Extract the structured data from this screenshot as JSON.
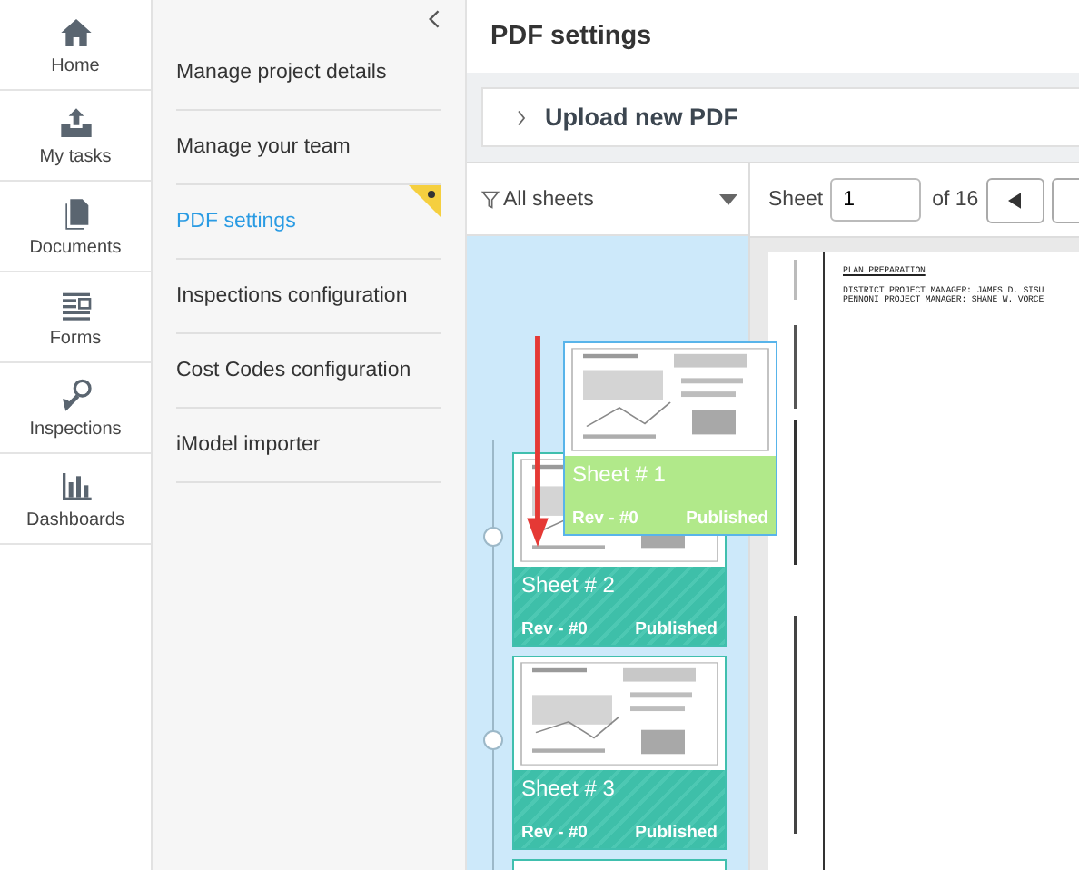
{
  "nav": [
    {
      "label": "Home"
    },
    {
      "label": "My tasks"
    },
    {
      "label": "Documents"
    },
    {
      "label": "Forms"
    },
    {
      "label": "Inspections"
    },
    {
      "label": "Dashboards"
    }
  ],
  "settings_menu": [
    {
      "label": "Manage project details",
      "selected": false
    },
    {
      "label": "Manage your team",
      "selected": false
    },
    {
      "label": "PDF settings",
      "selected": true
    },
    {
      "label": "Inspections configuration",
      "selected": false
    },
    {
      "label": "Cost Codes configuration",
      "selected": false
    },
    {
      "label": "iModel importer",
      "selected": false
    }
  ],
  "title": "PDF settings",
  "upload": {
    "label": "Upload new PDF",
    "expanded": false
  },
  "filter": {
    "label": "All sheets"
  },
  "pager": {
    "label": "Sheet",
    "value": "1",
    "total": "of 16"
  },
  "sheets": [
    {
      "title": "Sheet # 1",
      "rev": "Rev - #0",
      "status": "Published",
      "dragging": true
    },
    {
      "title": "Sheet # 2",
      "rev": "Rev - #0",
      "status": "Published",
      "dragging": false
    },
    {
      "title": "Sheet # 3",
      "rev": "Rev - #0",
      "status": "Published",
      "dragging": false
    }
  ],
  "document": {
    "heading": "PLAN PREPARATION",
    "lines": [
      "DISTRICT PROJECT MANAGER: JAMES D. SISU",
      "PENNONI PROJECT MANAGER: SHANE W. VORCE"
    ]
  }
}
